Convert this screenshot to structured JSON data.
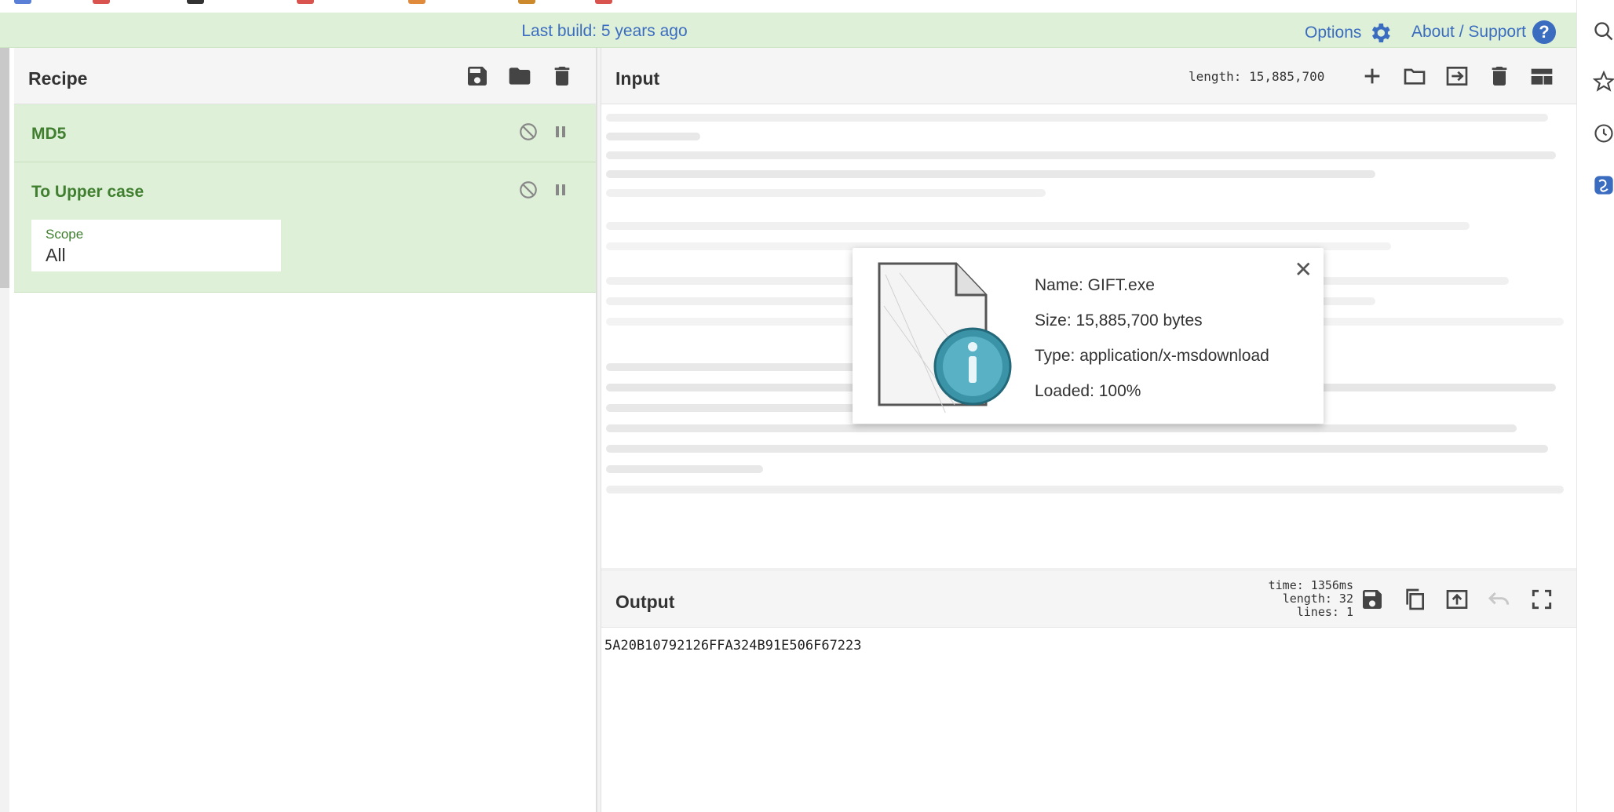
{
  "banner": {
    "build_text": "Last build: 5 years ago",
    "options_label": "Options",
    "about_label": "About / Support",
    "help_glyph": "?"
  },
  "recipe": {
    "title": "Recipe",
    "icons": [
      "save-icon",
      "folder-icon",
      "trash-icon"
    ],
    "operations": [
      {
        "name": "MD5",
        "controls": [
          "disable-icon",
          "pause-icon"
        ]
      },
      {
        "name": "To Upper case",
        "controls": [
          "disable-icon",
          "pause-icon"
        ],
        "args": [
          {
            "label": "Scope",
            "value": "All"
          }
        ]
      }
    ]
  },
  "input": {
    "title": "Input",
    "length_text": "length: 15,885,700",
    "icons": [
      "add-icon",
      "open-folder-icon",
      "load-icon",
      "trash-icon",
      "layout-icon"
    ]
  },
  "file_info": {
    "name": "Name: GIFT.exe",
    "size": "Size: 15,885,700 bytes",
    "type": "Type: application/x-msdownload",
    "loaded": "Loaded: 100%",
    "close_glyph": "✕"
  },
  "output": {
    "title": "Output",
    "time_text": "time: 1356ms",
    "length_text": "length:   32",
    "lines_text": "lines:    1",
    "value": "5A20B10792126FFA324B91E506F67223",
    "icons": [
      "save-icon",
      "copy-icon",
      "replace-input-icon",
      "undo-icon",
      "fullscreen-icon"
    ]
  },
  "colors": {
    "banner_bg": "#dff0d8",
    "link_blue": "#3a6cbf",
    "op_green": "#3f7f2f"
  }
}
